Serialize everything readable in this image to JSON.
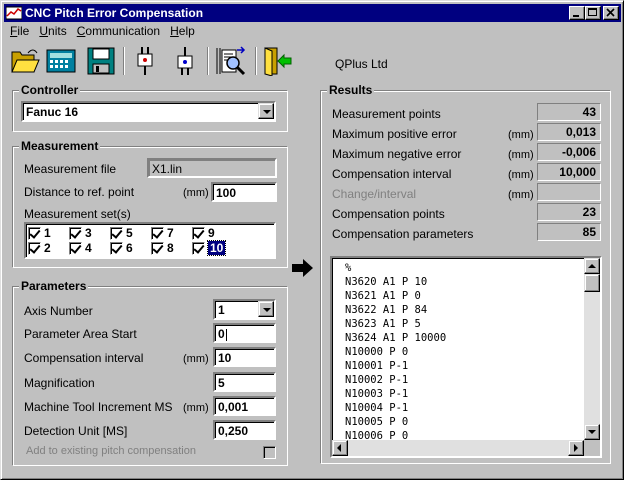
{
  "window": {
    "title": "CNC Pitch Error Compensation"
  },
  "menu": [
    "File",
    "Units",
    "Communication",
    "Help"
  ],
  "toolbar": {
    "buttons": [
      "open-folder-icon",
      "calculator-icon",
      "save-disk-icon",
      "send-to-cnc-icon",
      "receive-from-cnc-icon",
      "analyze-report-icon",
      "exit-door-icon"
    ],
    "company": "QPlus Ltd"
  },
  "controller": {
    "title": "Controller",
    "value": "Fanuc 16"
  },
  "measurement": {
    "title": "Measurement",
    "file_label": "Measurement file",
    "file_value": "X1.lin",
    "distance_label": "Distance to ref. point",
    "distance_unit": "(mm)",
    "distance_value": "100",
    "sets_label": "Measurement set(s)",
    "sets": [
      "1",
      "2",
      "3",
      "4",
      "5",
      "6",
      "7",
      "8",
      "9",
      "10"
    ]
  },
  "parameters": {
    "title": "Parameters",
    "axis_label": "Axis Number",
    "axis_value": "1",
    "area_label": "Parameter Area Start",
    "area_value": "0",
    "interval_label": "Compensation interval",
    "interval_unit": "(mm)",
    "interval_value": "10",
    "magnification_label": "Magnification",
    "magnification_value": "5",
    "increment_label": "Machine Tool Increment MS",
    "increment_unit": "(mm)",
    "increment_value": "0,001",
    "detection_label": "Detection Unit  [MS]",
    "detection_value": "0,250",
    "add_label": "Add to existing pitch compensation"
  },
  "results": {
    "title": "Results",
    "rows": [
      {
        "label": "Measurement points",
        "unit": "",
        "value": "43"
      },
      {
        "label": "Maximum positive error",
        "unit": "(mm)",
        "value": "0,013"
      },
      {
        "label": "Maximum negative error",
        "unit": "(mm)",
        "value": "-0,006"
      },
      {
        "label": "Compensation interval",
        "unit": "(mm)",
        "value": "10,000"
      },
      {
        "label": "Change/interval",
        "unit": "(mm)",
        "value": ""
      },
      {
        "label": "Compensation points",
        "unit": "",
        "value": "23"
      },
      {
        "label": "Compensation parameters",
        "unit": "",
        "value": "85"
      }
    ],
    "output": "%\nN3620 A1 P 10\nN3621 A1 P 0\nN3622 A1 P 84\nN3623 A1 P 5\nN3624 A1 P 10000\nN10000 P 0\nN10001 P-1\nN10002 P-1\nN10003 P-1\nN10004 P-1\nN10005 P 0\nN10006 P 0"
  }
}
